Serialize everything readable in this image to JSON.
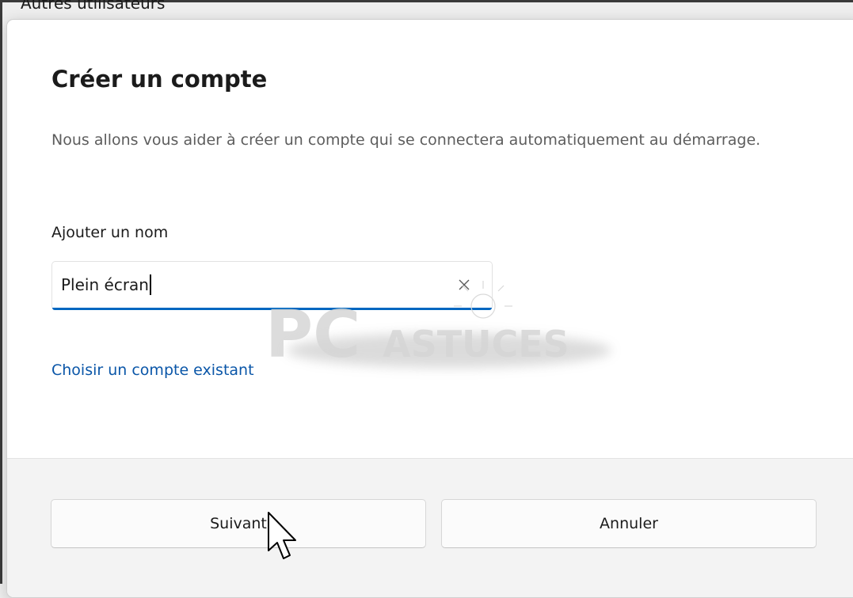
{
  "background": {
    "partial_label": "Autres utilisateurs"
  },
  "dialog": {
    "title": "Créer un compte",
    "description": "Nous allons vous aider à créer un compte qui se connectera automatiquement au démarrage.",
    "name_field": {
      "label": "Ajouter un nom",
      "value": "Plein écran",
      "clear_icon": "close-icon"
    },
    "existing_account_link": "Choisir un compte existant",
    "buttons": {
      "next": "Suivant",
      "cancel": "Annuler"
    }
  },
  "watermark": {
    "text_pc": "PC",
    "text_astuces": "ASTUCES"
  },
  "colors": {
    "accent": "#0067c0",
    "link": "#0a56a8",
    "footer_bg": "#f3f3f3"
  }
}
